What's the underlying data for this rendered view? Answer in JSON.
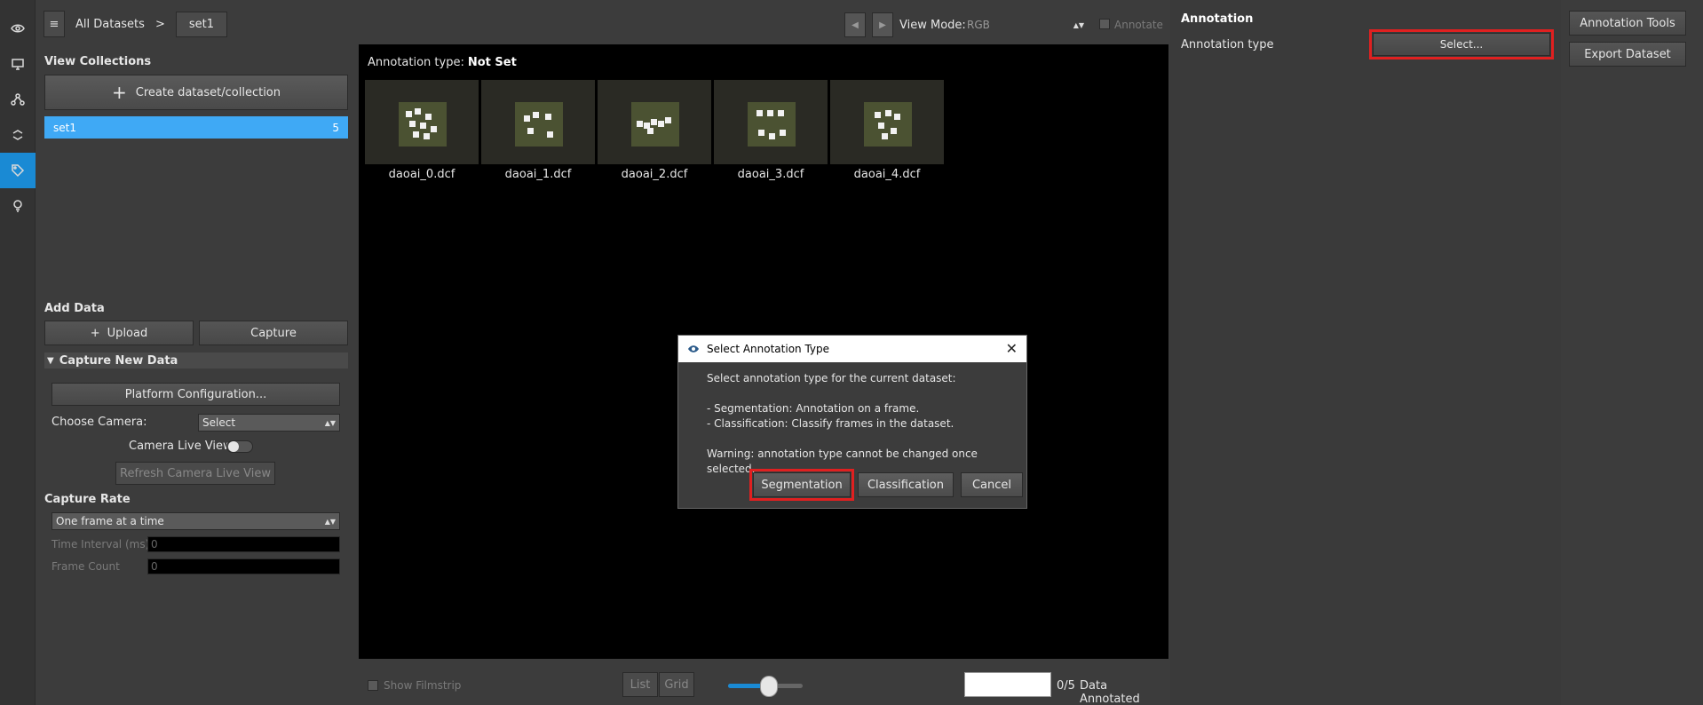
{
  "rail": {
    "icons": [
      "eye-icon",
      "monitor-icon",
      "network-icon",
      "recycle-icon",
      "tag-icon",
      "bulb-icon"
    ]
  },
  "breadcrumb": {
    "menu_glyph": "≡",
    "root": "All Datasets",
    "separator": ">",
    "current": "set1"
  },
  "collections": {
    "title": "View Collections",
    "create_button": "Create dataset/collection",
    "items": [
      {
        "name": "set1",
        "count": "5"
      }
    ]
  },
  "add_data": {
    "title": "Add Data",
    "upload_button": "Upload",
    "capture_button": "Capture",
    "capture_section": "Capture New Data",
    "platform_button": "Platform Configuration...",
    "choose_camera_label": "Choose Camera:",
    "camera_select": "Select",
    "live_view_label": "Camera Live View",
    "refresh_button": "Refresh Camera Live View",
    "capture_rate_title": "Capture Rate",
    "capture_rate_select": "One frame at a time",
    "time_interval_label": "Time Interval (ms)",
    "time_interval_value": "0",
    "frame_count_label": "Frame Count",
    "frame_count_value": "0"
  },
  "toolbar": {
    "prev": "◀",
    "next": "▶",
    "view_mode_label": "View Mode:",
    "view_mode_value": "RGB",
    "annotate_label": "Annotate"
  },
  "viewer": {
    "annotation_type_label": "Annotation type:",
    "annotation_type_value": "Not Set",
    "thumbnails": [
      "daoai_0.dcf",
      "daoai_1.dcf",
      "daoai_2.dcf",
      "daoai_3.dcf",
      "daoai_4.dcf"
    ]
  },
  "bottom": {
    "filmstrip_label": "Show Filmstrip",
    "list_button": "List",
    "grid_button": "Grid",
    "zoom_fraction": 0.55,
    "annotated_count": "0/5",
    "annotated_label": "Data Annotated"
  },
  "annotation_panel": {
    "title": "Annotation",
    "type_label": "Annotation type",
    "select_button": "Select..."
  },
  "tools": {
    "annotation_tools": "Annotation Tools",
    "export_dataset": "Export Dataset"
  },
  "dialog": {
    "title": "Select Annotation Type",
    "line1": "Select annotation type for the current dataset:",
    "line2": "- Segmentation: Annotation on a frame.",
    "line3": "- Classification: Classify frames in the dataset.",
    "line4": "Warning: annotation type cannot be changed once selected.",
    "segmentation_button": "Segmentation",
    "classification_button": "Classification",
    "cancel_button": "Cancel",
    "close_glyph": "✕"
  },
  "colors": {
    "accent": "#1a8ad4",
    "selected_row": "#3fa9f5",
    "highlight": "#e02020"
  }
}
